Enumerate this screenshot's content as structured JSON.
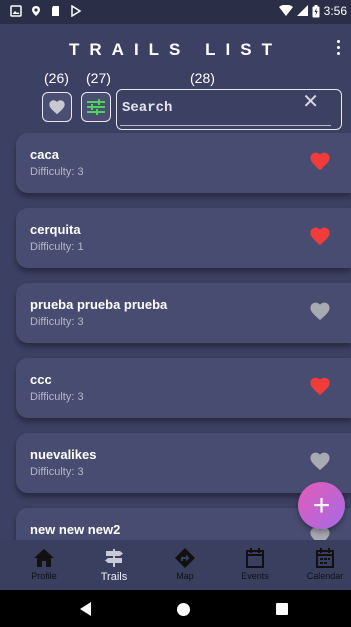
{
  "status_bar": {
    "time": "3:56"
  },
  "app_bar": {
    "title": "TRAILS LIST"
  },
  "annotations": {
    "fav": "(26)",
    "filter": "(27)",
    "search": "(28)"
  },
  "search": {
    "placeholder": "Search",
    "value": ""
  },
  "trails": [
    {
      "name": "caca",
      "difficulty": "Difficulty: 3",
      "liked": true
    },
    {
      "name": "cerquita",
      "difficulty": "Difficulty: 1",
      "liked": true
    },
    {
      "name": "prueba prueba prueba",
      "difficulty": "Difficulty: 3",
      "liked": false
    },
    {
      "name": "ccc",
      "difficulty": "Difficulty: 3",
      "liked": true
    },
    {
      "name": "nuevalikes",
      "difficulty": "Difficulty: 3",
      "liked": false
    },
    {
      "name": "new new new2",
      "difficulty": "",
      "liked": false
    }
  ],
  "bottom_nav": {
    "items": [
      "Profile",
      "Trails",
      "Map",
      "Events",
      "Calendar"
    ],
    "active": "Trails"
  },
  "colors": {
    "liked_heart": "#f23c3c",
    "unliked_heart": "#a9a9b2",
    "accent_gradient_start": "#e45bb8",
    "accent_gradient_end": "#a46be6"
  }
}
